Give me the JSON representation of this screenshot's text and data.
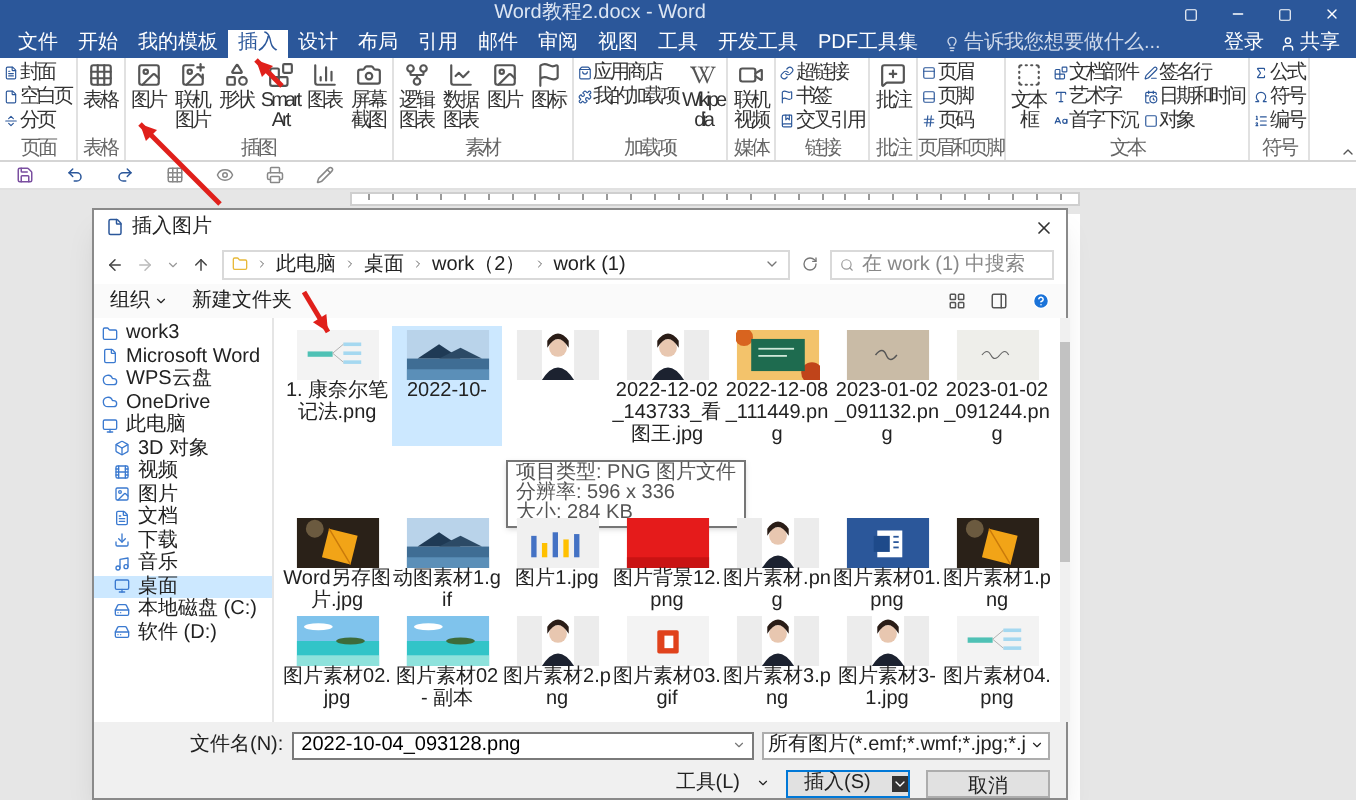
{
  "window": {
    "title": "Word教程2.docx - Word"
  },
  "tabs": [
    {
      "label": "文件",
      "selected": false
    },
    {
      "label": "开始",
      "selected": false
    },
    {
      "label": "我的模板",
      "selected": false
    },
    {
      "label": "插入",
      "selected": true
    },
    {
      "label": "设计",
      "selected": false
    },
    {
      "label": "布局",
      "selected": false
    },
    {
      "label": "引用",
      "selected": false
    },
    {
      "label": "邮件",
      "selected": false
    },
    {
      "label": "审阅",
      "selected": false
    },
    {
      "label": "视图",
      "selected": false
    },
    {
      "label": "工具",
      "selected": false
    },
    {
      "label": "开发工具",
      "selected": false
    },
    {
      "label": "PDF工具集",
      "selected": false
    }
  ],
  "tell_me": {
    "placeholder": "告诉我您想要做什么..."
  },
  "account": {
    "sign_in": "登录",
    "share": "共享"
  },
  "ribbon_groups": [
    {
      "label": "页面",
      "items": [
        {
          "kind": "small",
          "label": "封面"
        },
        {
          "kind": "small",
          "label": "空白页"
        },
        {
          "kind": "small",
          "label": "分页"
        }
      ]
    },
    {
      "label": "表格",
      "items": [
        {
          "kind": "large",
          "label": "表格"
        }
      ]
    },
    {
      "label": "插图",
      "items": [
        {
          "kind": "large",
          "label": "图片"
        },
        {
          "kind": "large",
          "label": "联机图片"
        },
        {
          "kind": "large",
          "label": "形状"
        },
        {
          "kind": "large",
          "label": "SmartArt"
        },
        {
          "kind": "large",
          "label": "图表"
        },
        {
          "kind": "large",
          "label": "屏幕截图"
        }
      ]
    },
    {
      "label": "素材",
      "items": [
        {
          "kind": "large",
          "label": "逻辑图表"
        },
        {
          "kind": "large",
          "label": "数据图表"
        },
        {
          "kind": "large",
          "label": "图片"
        },
        {
          "kind": "large",
          "label": "图标"
        }
      ]
    },
    {
      "label": "加载项",
      "items": [
        {
          "kind": "small",
          "label": "应用商店"
        },
        {
          "kind": "small",
          "label": "我的加载项"
        },
        {
          "kind": "large",
          "label": "Wikipedia"
        }
      ]
    },
    {
      "label": "媒体",
      "items": [
        {
          "kind": "large",
          "label": "联机视频"
        }
      ]
    },
    {
      "label": "链接",
      "items": [
        {
          "kind": "small",
          "label": "超链接"
        },
        {
          "kind": "small",
          "label": "书签"
        },
        {
          "kind": "small",
          "label": "交叉引用"
        }
      ]
    },
    {
      "label": "批注",
      "items": [
        {
          "kind": "large",
          "label": "批注"
        }
      ]
    },
    {
      "label": "页眉和页脚",
      "items": [
        {
          "kind": "small",
          "label": "页眉"
        },
        {
          "kind": "small",
          "label": "页脚"
        },
        {
          "kind": "small",
          "label": "页码"
        }
      ]
    },
    {
      "label": "文本",
      "items": [
        {
          "kind": "large",
          "label": "文本框"
        },
        {
          "kind": "small",
          "label": "文档部件"
        },
        {
          "kind": "small",
          "label": "艺术字"
        },
        {
          "kind": "small",
          "label": "首字下沉"
        },
        {
          "kind": "small",
          "label": "签名行"
        },
        {
          "kind": "small",
          "label": "日期和时间"
        },
        {
          "kind": "small",
          "label": "对象"
        }
      ]
    },
    {
      "label": "符号",
      "items": [
        {
          "kind": "small",
          "label": "公式"
        },
        {
          "kind": "small",
          "label": "符号"
        },
        {
          "kind": "small",
          "label": "编号"
        }
      ]
    }
  ],
  "dialog": {
    "title": "插入图片",
    "breadcrumb": [
      "此电脑",
      "桌面",
      "work（2）",
      "work (1)"
    ],
    "search": {
      "placeholder": "在 work (1) 中搜索"
    },
    "organize": "组织",
    "new_folder": "新建文件夹",
    "sidebar": [
      {
        "label": "work3",
        "selected": false
      },
      {
        "label": "Microsoft Word",
        "selected": false
      },
      {
        "label": "WPS云盘",
        "selected": false
      },
      {
        "label": "OneDrive",
        "selected": false
      },
      {
        "label": "此电脑",
        "selected": false,
        "children": [
          {
            "label": "3D 对象",
            "selected": false
          },
          {
            "label": "视频",
            "selected": false
          },
          {
            "label": "图片",
            "selected": false
          },
          {
            "label": "文档",
            "selected": false
          },
          {
            "label": "下载",
            "selected": false
          },
          {
            "label": "音乐",
            "selected": false
          },
          {
            "label": "桌面",
            "selected": true
          },
          {
            "label": "本地磁盘 (C:)",
            "selected": false
          },
          {
            "label": "软件 (D:)",
            "selected": false
          }
        ]
      }
    ],
    "files": [
      {
        "label": "1. 康奈尔笔记法.png",
        "selected": false
      },
      {
        "label": "2022-10-",
        "selected": true
      },
      {
        "selected": false
      },
      {
        "label": "2022-12-02_143733_看图王.jpg",
        "selected": false
      },
      {
        "label": "2022-12-08_111449.png",
        "selected": false
      },
      {
        "label": "2023-01-02_091132.png",
        "selected": false
      },
      {
        "label": "2023-01-02_091244.png",
        "selected": false
      },
      {
        "label": "Word另存图片.jpg",
        "selected": false
      },
      {
        "label": "动图素材1.gif",
        "selected": false
      },
      {
        "label": "图片1.jpg",
        "selected": false
      },
      {
        "label": "图片背景12.png",
        "selected": false
      },
      {
        "label": "图片素材.png",
        "selected": false
      },
      {
        "label": "图片素材01.png",
        "selected": false
      },
      {
        "label": "图片素材1.png",
        "selected": false
      },
      {
        "label": "图片素材02.jpg",
        "selected": false
      },
      {
        "label": "图片素材02 - 副本",
        "selected": false
      },
      {
        "label": "图片素材2.png",
        "selected": false
      },
      {
        "label": "图片素材03.gif",
        "selected": false
      },
      {
        "label": "图片素材3.png",
        "selected": false
      },
      {
        "label": "图片素材3-1.jpg",
        "selected": false
      },
      {
        "label": "图片素材04.png",
        "selected": false
      }
    ],
    "tooltip": [
      "项目类型: PNG 图片文件",
      "分辨率: 596 x 336",
      "大小: 284 KB"
    ],
    "filename_label": "文件名(N):",
    "filename": "2022-10-04_093128.png",
    "filetype": "所有图片(*.emf;*.wmf;*.jpg;*.j",
    "tools": "工具(L)",
    "insert": "插入(S)",
    "cancel": "取消"
  }
}
